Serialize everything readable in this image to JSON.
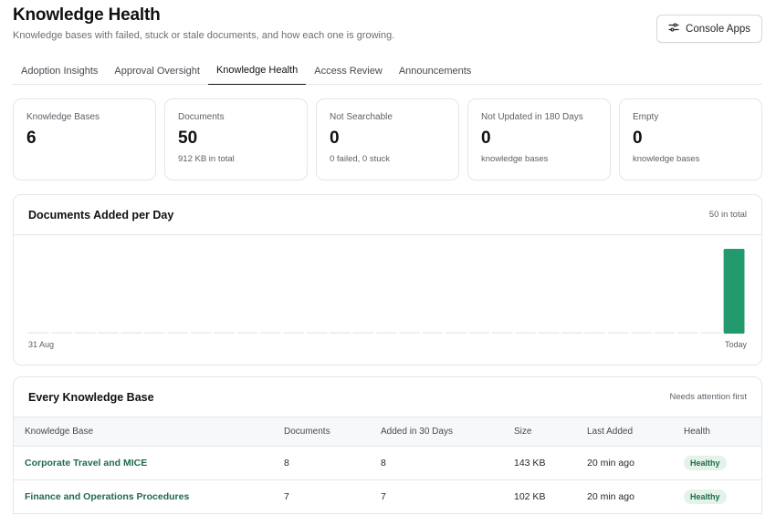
{
  "header": {
    "title": "Knowledge Health",
    "subtitle": "Knowledge bases with failed, stuck or stale documents, and how each one is growing.",
    "console_button_label": "Console Apps",
    "console_button_icon": "sliders-icon"
  },
  "tabs": [
    {
      "label": "Adoption Insights",
      "active": false
    },
    {
      "label": "Approval Oversight",
      "active": false
    },
    {
      "label": "Knowledge Health",
      "active": true
    },
    {
      "label": "Access Review",
      "active": false
    },
    {
      "label": "Announcements",
      "active": false
    }
  ],
  "stats": [
    {
      "label": "Knowledge Bases",
      "value": "6",
      "sub": ""
    },
    {
      "label": "Documents",
      "value": "50",
      "sub": "912 KB in total"
    },
    {
      "label": "Not Searchable",
      "value": "0",
      "sub": "0 failed, 0 stuck"
    },
    {
      "label": "Not Updated in 180 Days",
      "value": "0",
      "sub": "knowledge bases"
    },
    {
      "label": "Empty",
      "value": "0",
      "sub": "knowledge bases"
    }
  ],
  "chart_panel": {
    "title": "Documents Added per Day",
    "meta": "50 in total"
  },
  "chart_data": {
    "type": "bar",
    "title": "Documents Added per Day",
    "first_tick": "31 Aug",
    "last_tick": "Today",
    "values": [
      0,
      0,
      0,
      0,
      0,
      0,
      0,
      0,
      0,
      0,
      0,
      0,
      0,
      0,
      0,
      0,
      0,
      0,
      0,
      0,
      0,
      0,
      0,
      0,
      0,
      0,
      0,
      0,
      0,
      0,
      50
    ],
    "ylim": [
      0,
      50
    ],
    "bar_color": "#229a6e",
    "zero_color": "#e8eaec"
  },
  "table_panel": {
    "title": "Every Knowledge Base",
    "meta": "Needs attention first",
    "columns": [
      "Knowledge Base",
      "Documents",
      "Added in 30 Days",
      "Size",
      "Last Added",
      "Health"
    ],
    "rows": [
      {
        "name": "Corporate Travel and MICE",
        "documents": "8",
        "added": "8",
        "size": "143 KB",
        "last_added": "20 min ago",
        "health": "Healthy"
      },
      {
        "name": "Finance and Operations Procedures",
        "documents": "7",
        "added": "7",
        "size": "102 KB",
        "last_added": "20 min ago",
        "health": "Healthy"
      }
    ]
  },
  "colors": {
    "accent_green": "#1f6b4a",
    "badge_bg": "#e3f3ea"
  }
}
